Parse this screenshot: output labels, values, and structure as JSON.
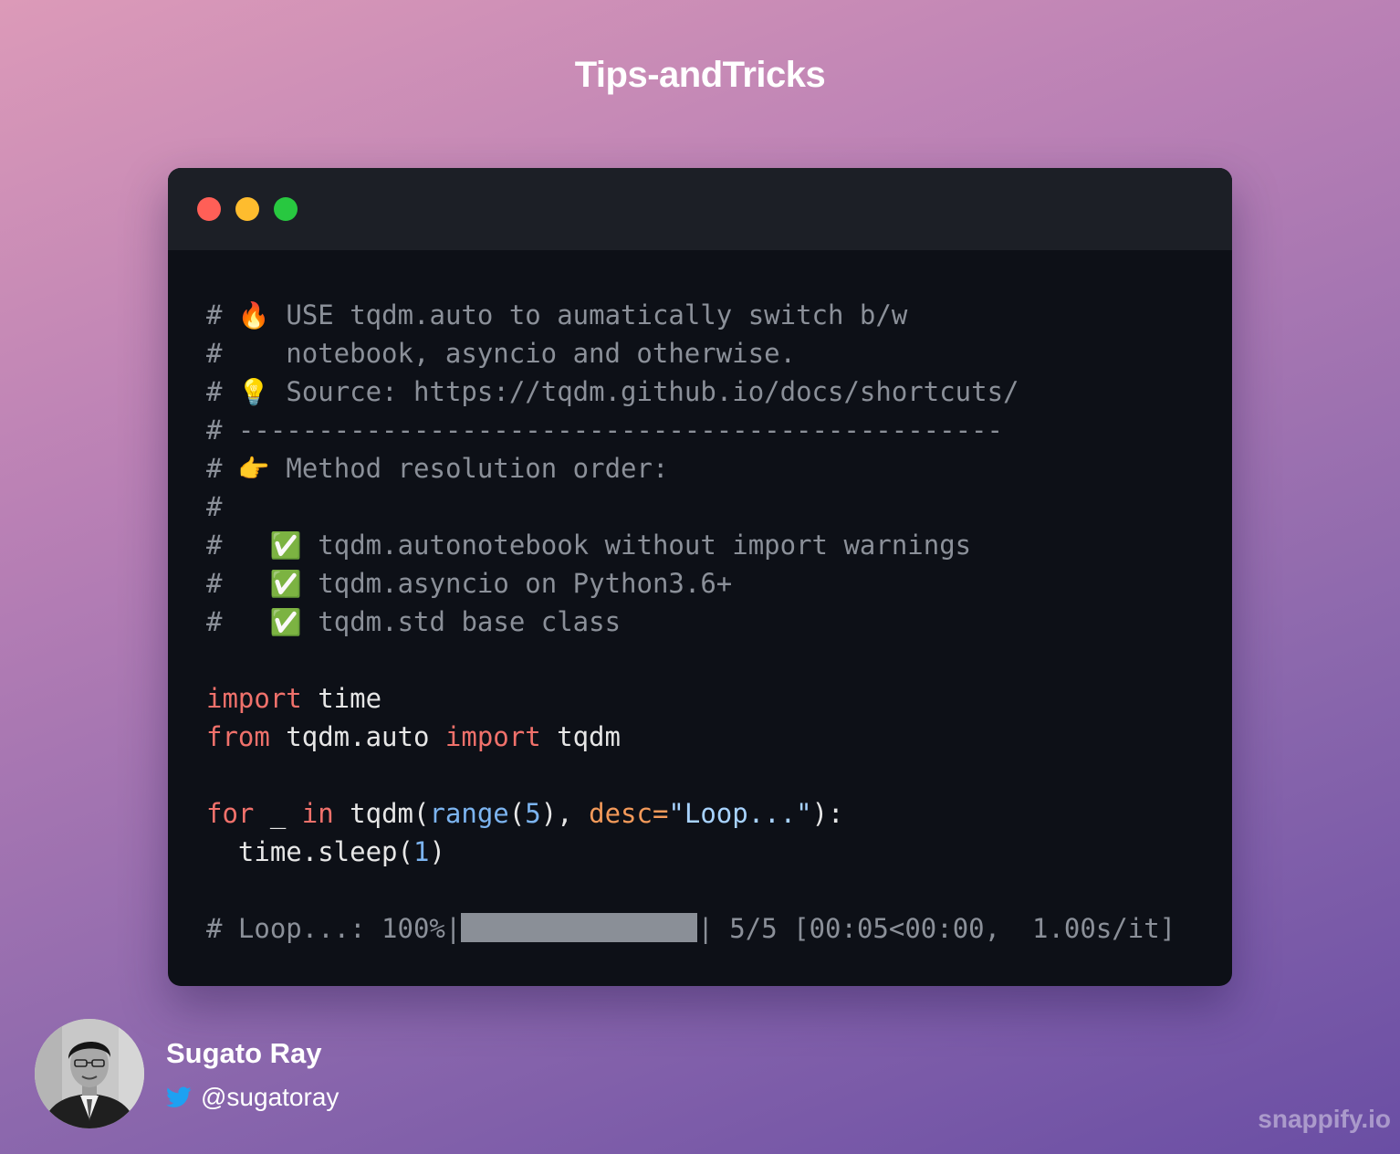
{
  "header": {
    "title": "Tips-andTricks"
  },
  "window": {
    "controls": [
      {
        "name": "close",
        "color": "#ff5f57"
      },
      {
        "name": "minimize",
        "color": "#febc2e"
      },
      {
        "name": "maximize",
        "color": "#28c840"
      }
    ],
    "code_lines": [
      {
        "tokens": [
          {
            "t": "c",
            "v": "# "
          },
          {
            "t": "emoji",
            "icon": "fire-icon",
            "v": "🔥"
          },
          {
            "t": "c",
            "v": " USE tqdm.auto to aumatically switch b/w"
          }
        ]
      },
      {
        "tokens": [
          {
            "t": "c",
            "v": "#    notebook, asyncio and otherwise."
          }
        ]
      },
      {
        "tokens": [
          {
            "t": "c",
            "v": "# "
          },
          {
            "t": "emoji",
            "icon": "lightbulb-icon",
            "v": "💡"
          },
          {
            "t": "c",
            "v": " Source: https://tqdm.github.io/docs/shortcuts/"
          }
        ]
      },
      {
        "tokens": [
          {
            "t": "c",
            "v": "# ------------------------------------------------"
          }
        ]
      },
      {
        "tokens": [
          {
            "t": "c",
            "v": "# "
          },
          {
            "t": "emoji",
            "icon": "pointing-right-icon",
            "v": "👉"
          },
          {
            "t": "c",
            "v": " Method resolution order:"
          }
        ]
      },
      {
        "tokens": [
          {
            "t": "c",
            "v": "#"
          }
        ]
      },
      {
        "tokens": [
          {
            "t": "c",
            "v": "#   "
          },
          {
            "t": "emoji",
            "icon": "check-mark-icon",
            "v": "✅"
          },
          {
            "t": "c",
            "v": " tqdm.autonotebook without import warnings"
          }
        ]
      },
      {
        "tokens": [
          {
            "t": "c",
            "v": "#   "
          },
          {
            "t": "emoji",
            "icon": "check-mark-icon",
            "v": "✅"
          },
          {
            "t": "c",
            "v": " tqdm.asyncio on Python3.6+"
          }
        ]
      },
      {
        "tokens": [
          {
            "t": "c",
            "v": "#   "
          },
          {
            "t": "emoji",
            "icon": "check-mark-icon",
            "v": "✅"
          },
          {
            "t": "c",
            "v": " tqdm.std base class"
          }
        ]
      },
      {
        "tokens": []
      },
      {
        "tokens": [
          {
            "t": "kw",
            "v": "import"
          },
          {
            "t": "id",
            "v": " time"
          }
        ]
      },
      {
        "tokens": [
          {
            "t": "kw",
            "v": "from"
          },
          {
            "t": "id",
            "v": " tqdm.auto "
          },
          {
            "t": "kw",
            "v": "import"
          },
          {
            "t": "id",
            "v": " tqdm"
          }
        ]
      },
      {
        "tokens": []
      },
      {
        "tokens": [
          {
            "t": "kw",
            "v": "for"
          },
          {
            "t": "id",
            "v": " _ "
          },
          {
            "t": "kw",
            "v": "in"
          },
          {
            "t": "id",
            "v": " tqdm("
          },
          {
            "t": "fn",
            "v": "range"
          },
          {
            "t": "id",
            "v": "("
          },
          {
            "t": "num",
            "v": "5"
          },
          {
            "t": "id",
            "v": "), "
          },
          {
            "t": "kwarg",
            "v": "desc="
          },
          {
            "t": "str",
            "v": "\"Loop...\""
          },
          {
            "t": "id",
            "v": "):"
          }
        ]
      },
      {
        "tokens": [
          {
            "t": "id",
            "v": "  time.sleep("
          },
          {
            "t": "num",
            "v": "1"
          },
          {
            "t": "id",
            "v": ")"
          }
        ]
      },
      {
        "tokens": []
      },
      {
        "tokens": [
          {
            "t": "c",
            "v": "# Loop...: 100%|"
          },
          {
            "t": "bar",
            "fill": 1.0
          },
          {
            "t": "c",
            "v": "| 5/5 [00:05<00:00,  1.00s/it]"
          }
        ]
      }
    ]
  },
  "author": {
    "name": "Sugato Ray",
    "handle": "@sugatoray",
    "twitter_color": "#1da1f2"
  },
  "watermark": "snappify.io"
}
